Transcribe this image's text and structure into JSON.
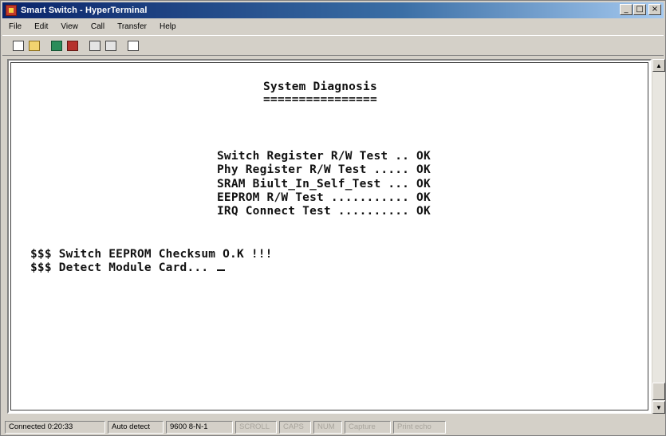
{
  "window": {
    "title": "Smart Switch - HyperTerminal",
    "controls": {
      "minimize": "_",
      "maximize": "□",
      "close": "×"
    }
  },
  "menu": [
    "File",
    "Edit",
    "View",
    "Call",
    "Transfer",
    "Help"
  ],
  "toolbar": {
    "buttons": [
      "new-icon",
      "open-icon",
      "connect-icon",
      "disconnect-icon",
      "send-icon",
      "receive-icon",
      "properties-icon"
    ]
  },
  "terminal": {
    "title": "System Diagnosis",
    "underline": "================",
    "tests": [
      {
        "text": "Switch Register R/W Test .. OK"
      },
      {
        "text": "Phy Register R/W Test ..... OK"
      },
      {
        "text": "SRAM Biult_In_Self_Test ... OK"
      },
      {
        "text": "EEPROM R/W Test ........... OK"
      },
      {
        "text": "IRQ Connect Test .......... OK"
      }
    ],
    "messages": [
      "$$$ Switch EEPROM Checksum O.K !!!",
      "$$$ Detect Module Card... "
    ]
  },
  "status": {
    "connected": "Connected 0:20:33",
    "detect": "Auto detect",
    "settings": "9600 8-N-1",
    "scroll": "SCROLL",
    "caps": "CAPS",
    "num": "NUM",
    "capture": "Capture",
    "print_echo": "Print echo"
  },
  "colors": {
    "titlebar_start": "#0a246a",
    "titlebar_end": "#a6caf0",
    "chrome": "#d4d0c8",
    "terminal_bg": "#ffffff",
    "terminal_text": "#111111"
  }
}
